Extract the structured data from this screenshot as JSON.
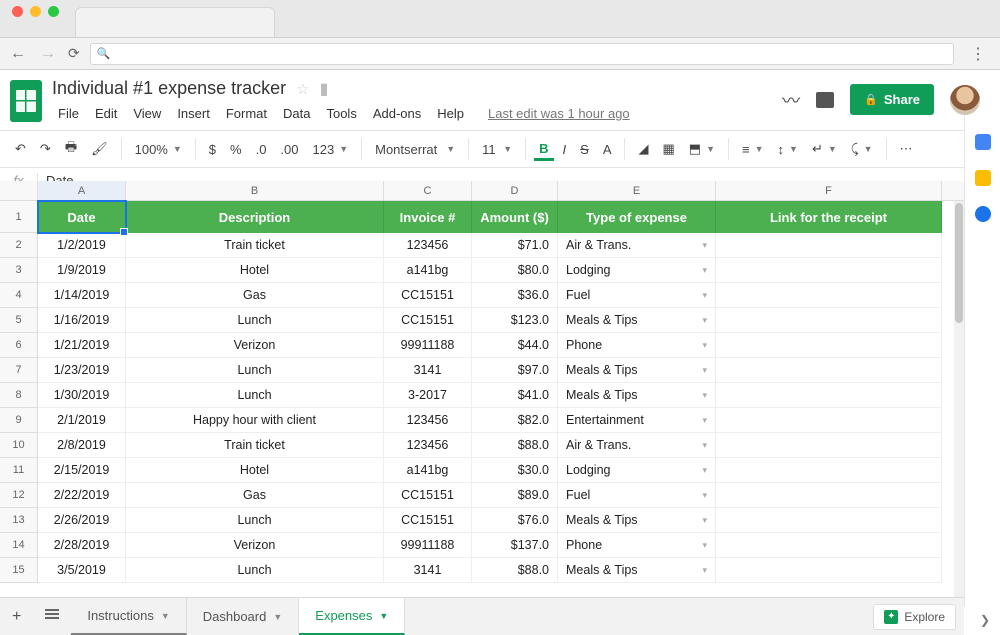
{
  "doc": {
    "title": "Individual #1 expense tracker",
    "last_edit": "Last edit was 1 hour ago",
    "share_label": "Share"
  },
  "menus": [
    "File",
    "Edit",
    "View",
    "Insert",
    "Format",
    "Data",
    "Tools",
    "Add-ons",
    "Help"
  ],
  "toolbar": {
    "zoom": "100%",
    "font": "Montserrat",
    "font_size": "11",
    "more_formats": "123"
  },
  "formula_bar": {
    "fx": "fx",
    "value": "Date"
  },
  "columns": [
    "A",
    "B",
    "C",
    "D",
    "E",
    "F"
  ],
  "header_row": {
    "row_num": "1",
    "cells": [
      "Date",
      "Description",
      "Invoice #",
      "Amount ($)",
      "Type of expense",
      "Link for the receipt"
    ]
  },
  "rows": [
    {
      "n": "2",
      "date": "1/2/2019",
      "desc": "Train ticket",
      "inv": "123456",
      "amt": "$71.0",
      "type": "Air & Trans."
    },
    {
      "n": "3",
      "date": "1/9/2019",
      "desc": "Hotel",
      "inv": "a141bg",
      "amt": "$80.0",
      "type": "Lodging"
    },
    {
      "n": "4",
      "date": "1/14/2019",
      "desc": "Gas",
      "inv": "CC15151",
      "amt": "$36.0",
      "type": "Fuel"
    },
    {
      "n": "5",
      "date": "1/16/2019",
      "desc": "Lunch",
      "inv": "CC15151",
      "amt": "$123.0",
      "type": "Meals & Tips"
    },
    {
      "n": "6",
      "date": "1/21/2019",
      "desc": "Verizon",
      "inv": "99911188",
      "amt": "$44.0",
      "type": "Phone"
    },
    {
      "n": "7",
      "date": "1/23/2019",
      "desc": "Lunch",
      "inv": "3141",
      "amt": "$97.0",
      "type": "Meals & Tips"
    },
    {
      "n": "8",
      "date": "1/30/2019",
      "desc": "Lunch",
      "inv": "3-2017",
      "amt": "$41.0",
      "type": "Meals & Tips"
    },
    {
      "n": "9",
      "date": "2/1/2019",
      "desc": "Happy hour with client",
      "inv": "123456",
      "amt": "$82.0",
      "type": "Entertainment"
    },
    {
      "n": "10",
      "date": "2/8/2019",
      "desc": "Train ticket",
      "inv": "123456",
      "amt": "$88.0",
      "type": "Air & Trans."
    },
    {
      "n": "11",
      "date": "2/15/2019",
      "desc": "Hotel",
      "inv": "a141bg",
      "amt": "$30.0",
      "type": "Lodging"
    },
    {
      "n": "12",
      "date": "2/22/2019",
      "desc": "Gas",
      "inv": "CC15151",
      "amt": "$89.0",
      "type": "Fuel"
    },
    {
      "n": "13",
      "date": "2/26/2019",
      "desc": "Lunch",
      "inv": "CC15151",
      "amt": "$76.0",
      "type": "Meals & Tips"
    },
    {
      "n": "14",
      "date": "2/28/2019",
      "desc": "Verizon",
      "inv": "99911188",
      "amt": "$137.0",
      "type": "Phone"
    },
    {
      "n": "15",
      "date": "3/5/2019",
      "desc": "Lunch",
      "inv": "3141",
      "amt": "$88.0",
      "type": "Meals & Tips"
    }
  ],
  "sheet_tabs": [
    "Instructions",
    "Dashboard",
    "Expenses"
  ],
  "explore": "Explore"
}
